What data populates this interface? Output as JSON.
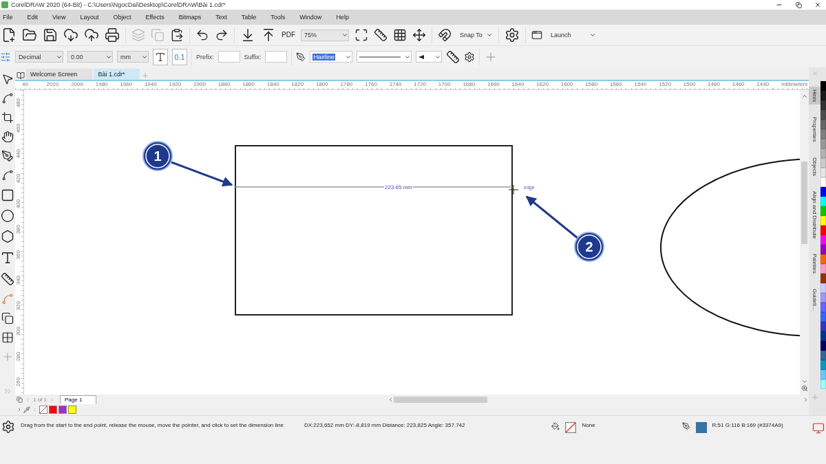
{
  "window": {
    "title": "CorelDRAW 2020 (64-Bit) - C:\\Users\\NgocDai\\Desktop\\CorelDRAW\\Bài 1.cdr*"
  },
  "menu": [
    "File",
    "Edit",
    "View",
    "Layout",
    "Object",
    "Effects",
    "Bitmaps",
    "Text",
    "Table",
    "Tools",
    "Window",
    "Help"
  ],
  "toolbar": {
    "pdf": "PDF",
    "zoom": "75%",
    "snap_to": "Snap To",
    "launch": "Launch"
  },
  "property_bar": {
    "numbering": "Decimal",
    "precision": "0.00",
    "units": "mm",
    "prefix_label": "Prefix:",
    "suffix_label": "Suffix:",
    "outline_width": "Hairline",
    "precision_sample": "0.1"
  },
  "tabs": [
    {
      "label": "Welcome Screen",
      "selected": false
    },
    {
      "label": "Bài 1.cdr*",
      "selected": true
    }
  ],
  "ruler": {
    "horizontal": [
      "40",
      "2020",
      "2000",
      "1980",
      "1960",
      "1940",
      "1920",
      "1900",
      "1880",
      "1860",
      "1840",
      "1820",
      "1800",
      "1780",
      "1760",
      "1740",
      "1720",
      "1700",
      "1680",
      "1660",
      "1640",
      "1620",
      "1600",
      "1580",
      "1560",
      "1540",
      "1520",
      "1500",
      "1480",
      "1460",
      "1440"
    ],
    "unit": "millimeters",
    "vertical": [
      "480",
      "460",
      "440",
      "420",
      "400",
      "380",
      "360",
      "340",
      "320",
      "300",
      "280",
      "260"
    ]
  },
  "canvas": {
    "dimension_label": "223.65 mm",
    "snap_label": "edge",
    "callouts": [
      "1",
      "2"
    ]
  },
  "docker_tabs": [
    {
      "label": "Hints",
      "selected": true
    },
    {
      "label": "Properties",
      "selected": false
    },
    {
      "label": "Objects",
      "selected": false
    },
    {
      "label": "Align and Distribute",
      "selected": false
    },
    {
      "label": "Palettes",
      "selected": false
    },
    {
      "label": "Guideli...",
      "selected": false
    }
  ],
  "palette": [
    {
      "color": "#000000"
    },
    {
      "color": "#1a1a1a"
    },
    {
      "color": "#333333"
    },
    {
      "color": "#4d4d4d"
    },
    {
      "color": "#666666"
    },
    {
      "color": "#808080"
    },
    {
      "color": "#999999"
    },
    {
      "color": "#b3b3b3"
    },
    {
      "color": "#cccccc"
    },
    {
      "color": "#e6e6e6"
    },
    {
      "color": "#ffffff"
    },
    {
      "color": "#0000ff"
    },
    {
      "color": "#00ffff"
    },
    {
      "color": "#00cc00"
    },
    {
      "color": "#ffff00"
    },
    {
      "color": "#ff0000"
    },
    {
      "color": "#ff00ff"
    },
    {
      "color": "#9900cc"
    },
    {
      "color": "#ff6600"
    },
    {
      "color": "#ff99cc"
    },
    {
      "color": "#993300"
    },
    {
      "color": "#ccccff"
    },
    {
      "color": "#9999ff"
    },
    {
      "color": "#6666ff"
    },
    {
      "color": "#3366ff"
    },
    {
      "color": "#3333cc"
    },
    {
      "color": "#003399"
    },
    {
      "color": "#000066"
    },
    {
      "color": "#336699"
    },
    {
      "color": "#0099cc"
    },
    {
      "color": "#66ccff"
    },
    {
      "color": "#99ffff"
    }
  ],
  "page_nav": {
    "page_count": "1 of 1",
    "page_tab": "Page 1"
  },
  "document_palette": [
    {
      "color": "#ff0000"
    },
    {
      "color": "#9b30d0"
    },
    {
      "color": "#ffff00"
    }
  ],
  "status": {
    "hint": "Drag from the start to the end point, release the mouse, move the pointer, and click to set the dimension line",
    "measure": "DX:223,652 mm DY:-8,819 mm Distance: 223,825 Angle: 357.742",
    "fill": "None",
    "outline_swatch": {
      "color": "#3374a9"
    },
    "outline": "R:51 G:116 B:169 (#3374A9)"
  }
}
